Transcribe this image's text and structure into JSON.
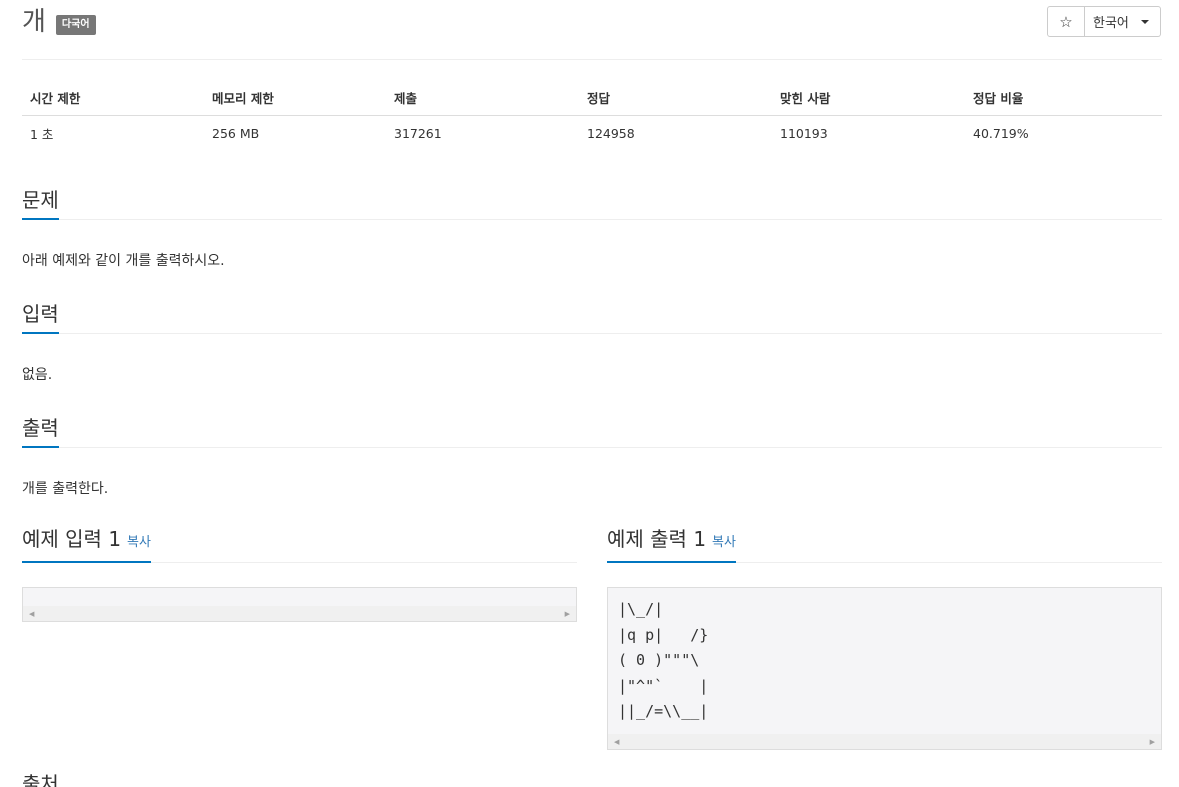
{
  "problem": {
    "title": "개",
    "badge": "다국어"
  },
  "toolbar": {
    "star_icon": "☆",
    "language_label": "한국어"
  },
  "stats": {
    "headers": [
      "시간 제한",
      "메모리 제한",
      "제출",
      "정답",
      "맞힌 사람",
      "정답 비율"
    ],
    "values": [
      "1 초",
      "256 MB",
      "317261",
      "124958",
      "110193",
      "40.719%"
    ]
  },
  "sections": {
    "description": {
      "title": "문제",
      "body": "아래 예제와 같이 개를 출력하시오."
    },
    "input": {
      "title": "입력",
      "body": "없음."
    },
    "output": {
      "title": "출력",
      "body": "개를 출력한다."
    },
    "source": {
      "title": "출처"
    }
  },
  "samples": {
    "input": {
      "title": "예제 입력 1",
      "copy_label": "복사",
      "content": ""
    },
    "output": {
      "title": "예제 출력 1",
      "copy_label": "복사",
      "content": "|\\_/|\n|q p|   /}\n( 0 )\"\"\"\\\n|\"^\"`    |\n||_/=\\\\__|"
    }
  },
  "colors": {
    "accent": "#0076c0",
    "link": "#337ab7",
    "badge": "#777777",
    "sample_bg": "#f5f5f7"
  }
}
